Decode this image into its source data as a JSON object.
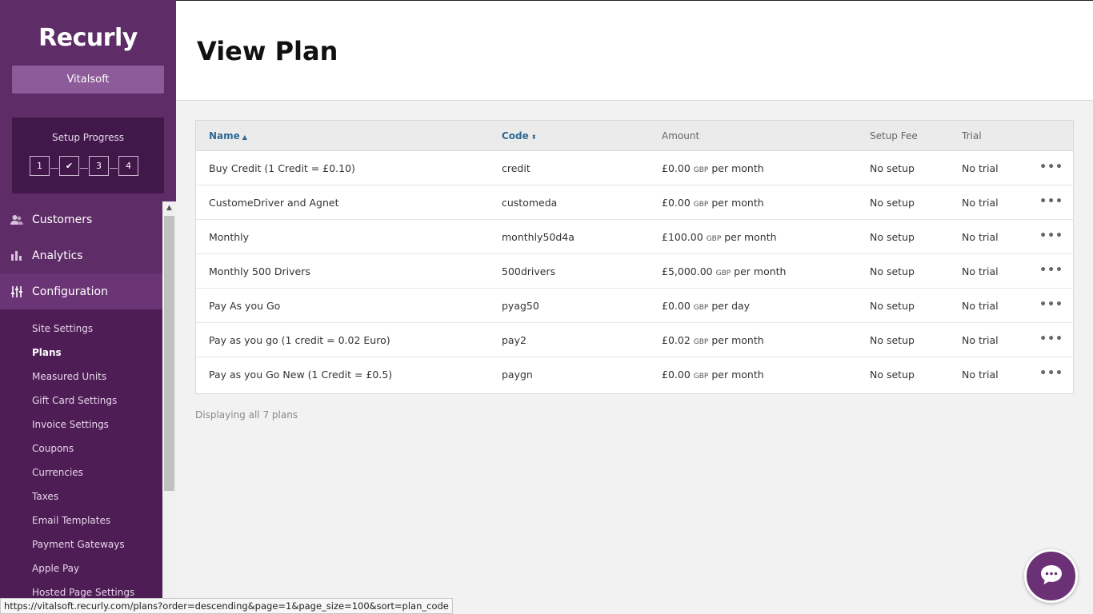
{
  "app": {
    "logo": "Recurly",
    "account": "Vitalsoft"
  },
  "setup": {
    "title": "Setup Progress",
    "steps": [
      "1",
      "✔",
      "3",
      "4"
    ]
  },
  "nav": {
    "customers": "Customers",
    "analytics": "Analytics",
    "configuration": "Configuration"
  },
  "submenu": [
    "Site Settings",
    "Plans",
    "Measured Units",
    "Gift Card Settings",
    "Invoice Settings",
    "Coupons",
    "Currencies",
    "Taxes",
    "Email Templates",
    "Payment Gateways",
    "Apple Pay",
    "Hosted Page Settings"
  ],
  "page": {
    "title": "View Plan"
  },
  "table": {
    "headers": {
      "name": "Name",
      "code": "Code",
      "amount": "Amount",
      "setup_fee": "Setup Fee",
      "trial": "Trial"
    },
    "rows": [
      {
        "name": "Buy Credit (1 Credit = £0.10)",
        "code": "credit",
        "amount": "£0.00",
        "currency": "GBP",
        "period": "per month",
        "setup": "No setup",
        "trial": "No trial"
      },
      {
        "name": "CustomeDriver and Agnet",
        "code": "customeda",
        "amount": "£0.00",
        "currency": "GBP",
        "period": "per month",
        "setup": "No setup",
        "trial": "No trial"
      },
      {
        "name": "Monthly",
        "code": "monthly50d4a",
        "amount": "£100.00",
        "currency": "GBP",
        "period": "per month",
        "setup": "No setup",
        "trial": "No trial"
      },
      {
        "name": "Monthly 500 Drivers",
        "code": "500drivers",
        "amount": "£5,000.00",
        "currency": "GBP",
        "period": "per month",
        "setup": "No setup",
        "trial": "No trial"
      },
      {
        "name": "Pay As you Go",
        "code": "pyag50",
        "amount": "£0.00",
        "currency": "GBP",
        "period": "per day",
        "setup": "No setup",
        "trial": "No trial"
      },
      {
        "name": "Pay as you go (1 credit = 0.02 Euro)",
        "code": "pay2",
        "amount": "£0.02",
        "currency": "GBP",
        "period": "per month",
        "setup": "No setup",
        "trial": "No trial"
      },
      {
        "name": "Pay as you Go New (1 Credit = £0.5)",
        "code": "paygn",
        "amount": "£0.00",
        "currency": "GBP",
        "period": "per month",
        "setup": "No setup",
        "trial": "No trial"
      }
    ],
    "row_actions_icon": "more-dots-icon"
  },
  "footer": {
    "count_text": "Displaying all 7 plans"
  },
  "status_bar": {
    "url": "https://vitalsoft.recurly.com/plans?order=descending&page=1&page_size=100&sort=plan_code"
  },
  "chat": {
    "icon": "chat-bubble-icon"
  },
  "colors": {
    "sidebar": "#4f1d55",
    "sidebar_top": "#5e2c66",
    "accent_link": "#2f6a96",
    "chat": "#6b3075"
  }
}
